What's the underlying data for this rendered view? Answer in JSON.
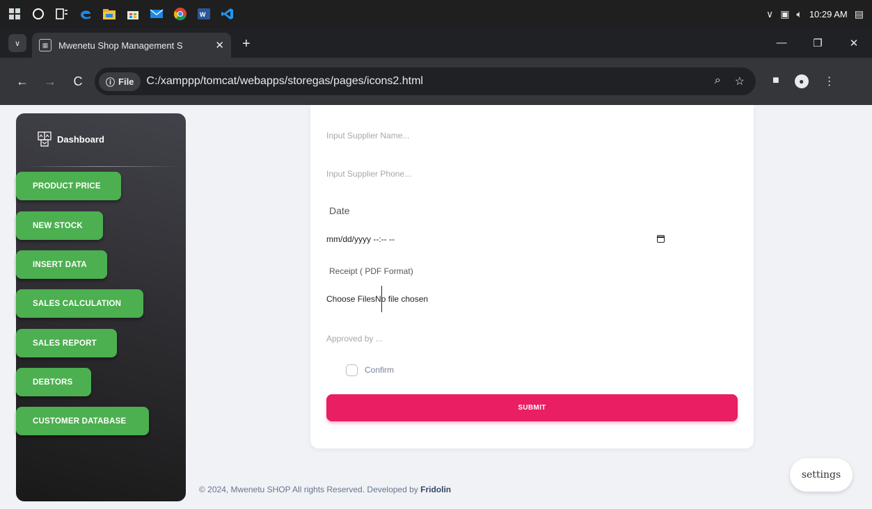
{
  "taskbar": {
    "time": "10:29 AM",
    "icons": [
      "windows-icon",
      "cortana-icon",
      "task-view-icon",
      "edge-icon",
      "file-explorer-icon",
      "store-icon",
      "mail-icon",
      "chrome-icon",
      "word-icon",
      "vscode-icon"
    ],
    "tray_symbols": {
      "chevron": "∨",
      "network": "▣",
      "volume": "🔈︎",
      "notify": "▤"
    }
  },
  "browser": {
    "tab_menu": "∨",
    "tab_title": "Mwenetu Shop Management S",
    "tab_close": "✕",
    "new_tab": "+",
    "win_min": "—",
    "win_restore": "❐",
    "win_close": "✕",
    "back": "←",
    "forward": "→",
    "reload": "C",
    "site_info": "ⓘ",
    "chip_label": "File",
    "url": "C:/xamppp/tomcat/webapps/storegas/pages/icons2.html",
    "zoom_icon": "⌕",
    "star_icon": "☆",
    "sidepanel_icon": "■",
    "profile_icon": "●",
    "menu_icon": "⋮"
  },
  "sidebar": {
    "brand": "Dashboard",
    "items": [
      {
        "label": "PRODUCT PRICE"
      },
      {
        "label": "NEW STOCK"
      },
      {
        "label": "INSERT DATA"
      },
      {
        "label": "SALES CALCULATION"
      },
      {
        "label": "SALES REPORT"
      },
      {
        "label": "DEBTORS"
      },
      {
        "label": "CUSTOMER DATABASE"
      }
    ]
  },
  "form": {
    "supplier_name_placeholder": "Input Supplier Name...",
    "supplier_phone_placeholder": "Input Supplier Phone...",
    "date_label": "Date",
    "date_value": "mm/dd/yyyy --:-- --",
    "receipt_label": "Receipt ( PDF Format)",
    "file_value": "Choose FilesNo file chosen",
    "approved_placeholder": "Approved by ...",
    "confirm_label": "Confirm",
    "submit_label": "SUBMIT"
  },
  "footer": {
    "text": "© 2024, Mwenetu SHOP All rights Reserved. Developed by ",
    "author": "Fridolin"
  },
  "settings_label": "settings",
  "colors": {
    "accent": "#e91e63",
    "nav_green": "#4caf50",
    "sidebar_dark": "#191919"
  }
}
